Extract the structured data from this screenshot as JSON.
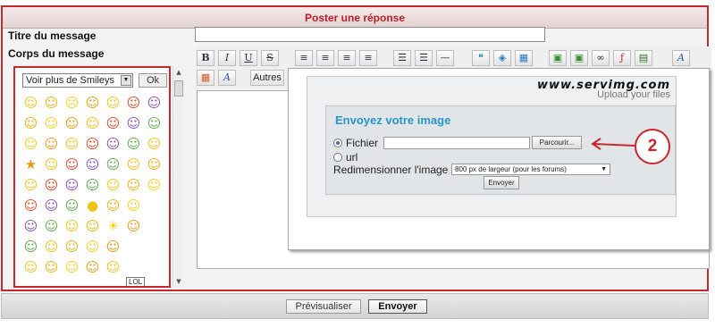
{
  "header": {
    "title": "Poster une réponse"
  },
  "form": {
    "title_label": "Titre du message",
    "body_label": "Corps du message",
    "title_value": ""
  },
  "smileys": {
    "select_value": "Voir plus de Smileys",
    "ok_label": "Ok",
    "rows": [
      [
        "☺",
        "☺",
        "☹",
        "☺",
        "☺",
        "☺",
        "☺"
      ],
      [
        "☺",
        "☺",
        "☺",
        "☺",
        "☺",
        "☺",
        "☺"
      ],
      [
        "☺",
        "☺",
        "☺",
        "☺",
        "☺",
        "☺",
        "☺"
      ],
      [
        "★",
        "☺",
        "☺",
        "☺",
        "☺",
        "☺",
        "☺"
      ],
      [
        "☺",
        "☺",
        "☺",
        "☺",
        "☺",
        "☺",
        "☺"
      ],
      [
        "☺",
        "☺",
        "☺",
        "●",
        "☺",
        "☺",
        ""
      ],
      [
        "☺",
        "☺",
        "☺",
        "☺",
        "☀",
        "☺",
        ""
      ],
      [
        "☺",
        "☺",
        "☺",
        "☺",
        "☺",
        "",
        ""
      ],
      [
        "☺",
        "☺",
        "☺",
        "☺",
        "☺",
        "",
        ""
      ]
    ],
    "sign_text": "LOL"
  },
  "toolbar": {
    "bold": "B",
    "italic": "I",
    "underline": "U",
    "strike": "S",
    "autres_label": "Autres"
  },
  "upload": {
    "logo_text": "www.servimg.com",
    "logo_sub": "Upload your files",
    "title": "Envoyez votre image",
    "file_label": "Fichier",
    "browse_label": "Parcourir...",
    "url_label": "url",
    "resize_label": "Redimensionner l'image",
    "resize_value": "800 px de largeur (pour les forums)",
    "send_label": "Envoyer"
  },
  "annotation": {
    "number": "2"
  },
  "buttons": {
    "preview": "Prévisualiser",
    "submit": "Envoyer"
  },
  "colors": {
    "accent_red": "#c7272f",
    "title_blue": "#2796c8"
  }
}
